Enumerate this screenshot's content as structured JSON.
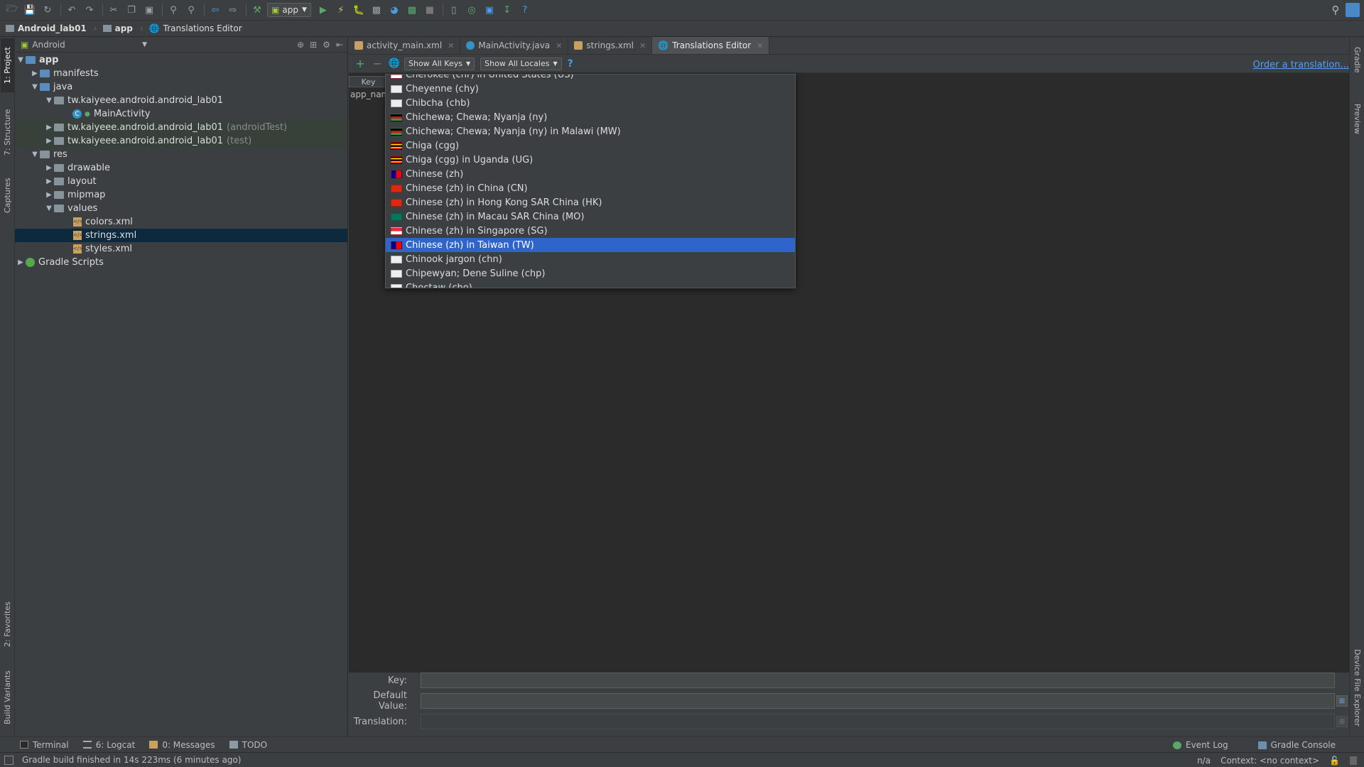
{
  "toolbar": {
    "run_config": "app"
  },
  "breadcrumb": {
    "project": "Android_lab01",
    "module": "app",
    "editor": "Translations Editor"
  },
  "left_tabs": {
    "project": "1: Project",
    "structure": "7: Structure",
    "captures": "Captures",
    "favorites": "2: Favorites",
    "build_variants": "Build Variants"
  },
  "right_tabs": {
    "gradle": "Gradle",
    "preview": "Preview",
    "device_explorer": "Device File Explorer"
  },
  "project_panel": {
    "view_mode": "Android",
    "tree": [
      {
        "label": "app",
        "dim": ""
      },
      {
        "label": "manifests",
        "dim": ""
      },
      {
        "label": "java",
        "dim": ""
      },
      {
        "label": "tw.kaiyeee.android.android_lab01",
        "dim": ""
      },
      {
        "label": "MainActivity",
        "dim": ""
      },
      {
        "label": "tw.kaiyeee.android.android_lab01",
        "dim": "(androidTest)"
      },
      {
        "label": "tw.kaiyeee.android.android_lab01",
        "dim": "(test)"
      },
      {
        "label": "res",
        "dim": ""
      },
      {
        "label": "drawable",
        "dim": ""
      },
      {
        "label": "layout",
        "dim": ""
      },
      {
        "label": "mipmap",
        "dim": ""
      },
      {
        "label": "values",
        "dim": ""
      },
      {
        "label": "colors.xml",
        "dim": ""
      },
      {
        "label": "strings.xml",
        "dim": ""
      },
      {
        "label": "styles.xml",
        "dim": ""
      },
      {
        "label": "Gradle Scripts",
        "dim": ""
      }
    ]
  },
  "tabs": [
    {
      "label": "activity_main.xml"
    },
    {
      "label": "MainActivity.java"
    },
    {
      "label": "strings.xml"
    },
    {
      "label": "Translations Editor"
    }
  ],
  "editor": {
    "keys_filter": "Show All Keys",
    "locales_filter": "Show All Locales",
    "order_link": "Order a translation...",
    "key_header": "Key",
    "key_cell": "app_name"
  },
  "locales": [
    {
      "label": "Cherokee (chr) in United States (US)"
    },
    {
      "label": "Cheyenne (chy)"
    },
    {
      "label": "Chibcha (chb)"
    },
    {
      "label": "Chichewa; Chewa; Nyanja (ny)"
    },
    {
      "label": "Chichewa; Chewa; Nyanja (ny) in Malawi (MW)"
    },
    {
      "label": "Chiga (cgg)"
    },
    {
      "label": "Chiga (cgg) in Uganda (UG)"
    },
    {
      "label": "Chinese (zh)"
    },
    {
      "label": "Chinese (zh) in China (CN)"
    },
    {
      "label": "Chinese (zh) in Hong Kong SAR China (HK)"
    },
    {
      "label": "Chinese (zh) in Macau SAR China (MO)"
    },
    {
      "label": "Chinese (zh) in Singapore (SG)"
    },
    {
      "label": "Chinese (zh) in Taiwan (TW)"
    },
    {
      "label": "Chinook jargon (chn)"
    },
    {
      "label": "Chipewyan; Dene Suline (chp)"
    },
    {
      "label": "Choctaw (cho)"
    }
  ],
  "form": {
    "key_label": "Key:",
    "default_label": "Default Value:",
    "translation_label": "Translation:"
  },
  "bottom_tools": {
    "terminal": "Terminal",
    "logcat": "6: Logcat",
    "messages": "0: Messages",
    "todo": "TODO",
    "event_log": "Event Log",
    "gradle_console": "Gradle Console"
  },
  "status": {
    "message": "Gradle build finished in 14s 223ms (6 minutes ago)",
    "position": "n/a",
    "context": "Context: <no context>"
  }
}
